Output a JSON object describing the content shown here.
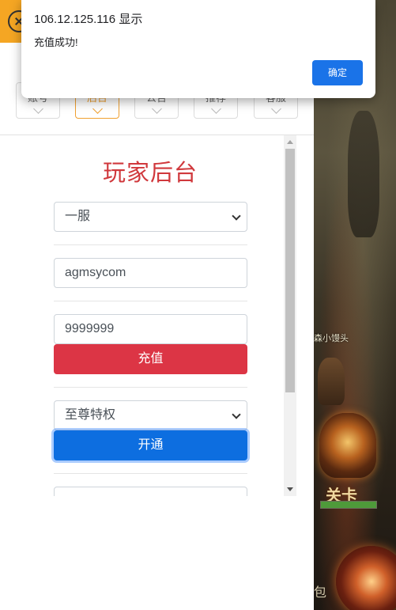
{
  "dialog": {
    "title": "106.12.125.116 显示",
    "message": "充值成功!",
    "ok_label": "确定"
  },
  "tabs": [
    {
      "label": "账号",
      "active": false
    },
    {
      "label": "后台",
      "active": true
    },
    {
      "label": "公告",
      "active": false
    },
    {
      "label": "推荐",
      "active": false
    },
    {
      "label": "客服",
      "active": false
    }
  ],
  "panel": {
    "title": "玩家后台",
    "server_select": {
      "value": "一服"
    },
    "account_input": {
      "value": "agmsycom"
    },
    "amount_input": {
      "value": "9999999"
    },
    "recharge_button": "充值",
    "privilege_select": {
      "value": "至尊特权"
    },
    "activate_button": "开通"
  },
  "game": {
    "player_name": "森小馒头",
    "stage_label": "关卡",
    "corner_text": "包",
    "hp_fraction": 1.0
  },
  "colors": {
    "header": "#f5a623",
    "title": "#d0383c",
    "recharge": "#dc3545",
    "activate": "#0d6ee0",
    "dialog_button": "#1a73e8"
  }
}
